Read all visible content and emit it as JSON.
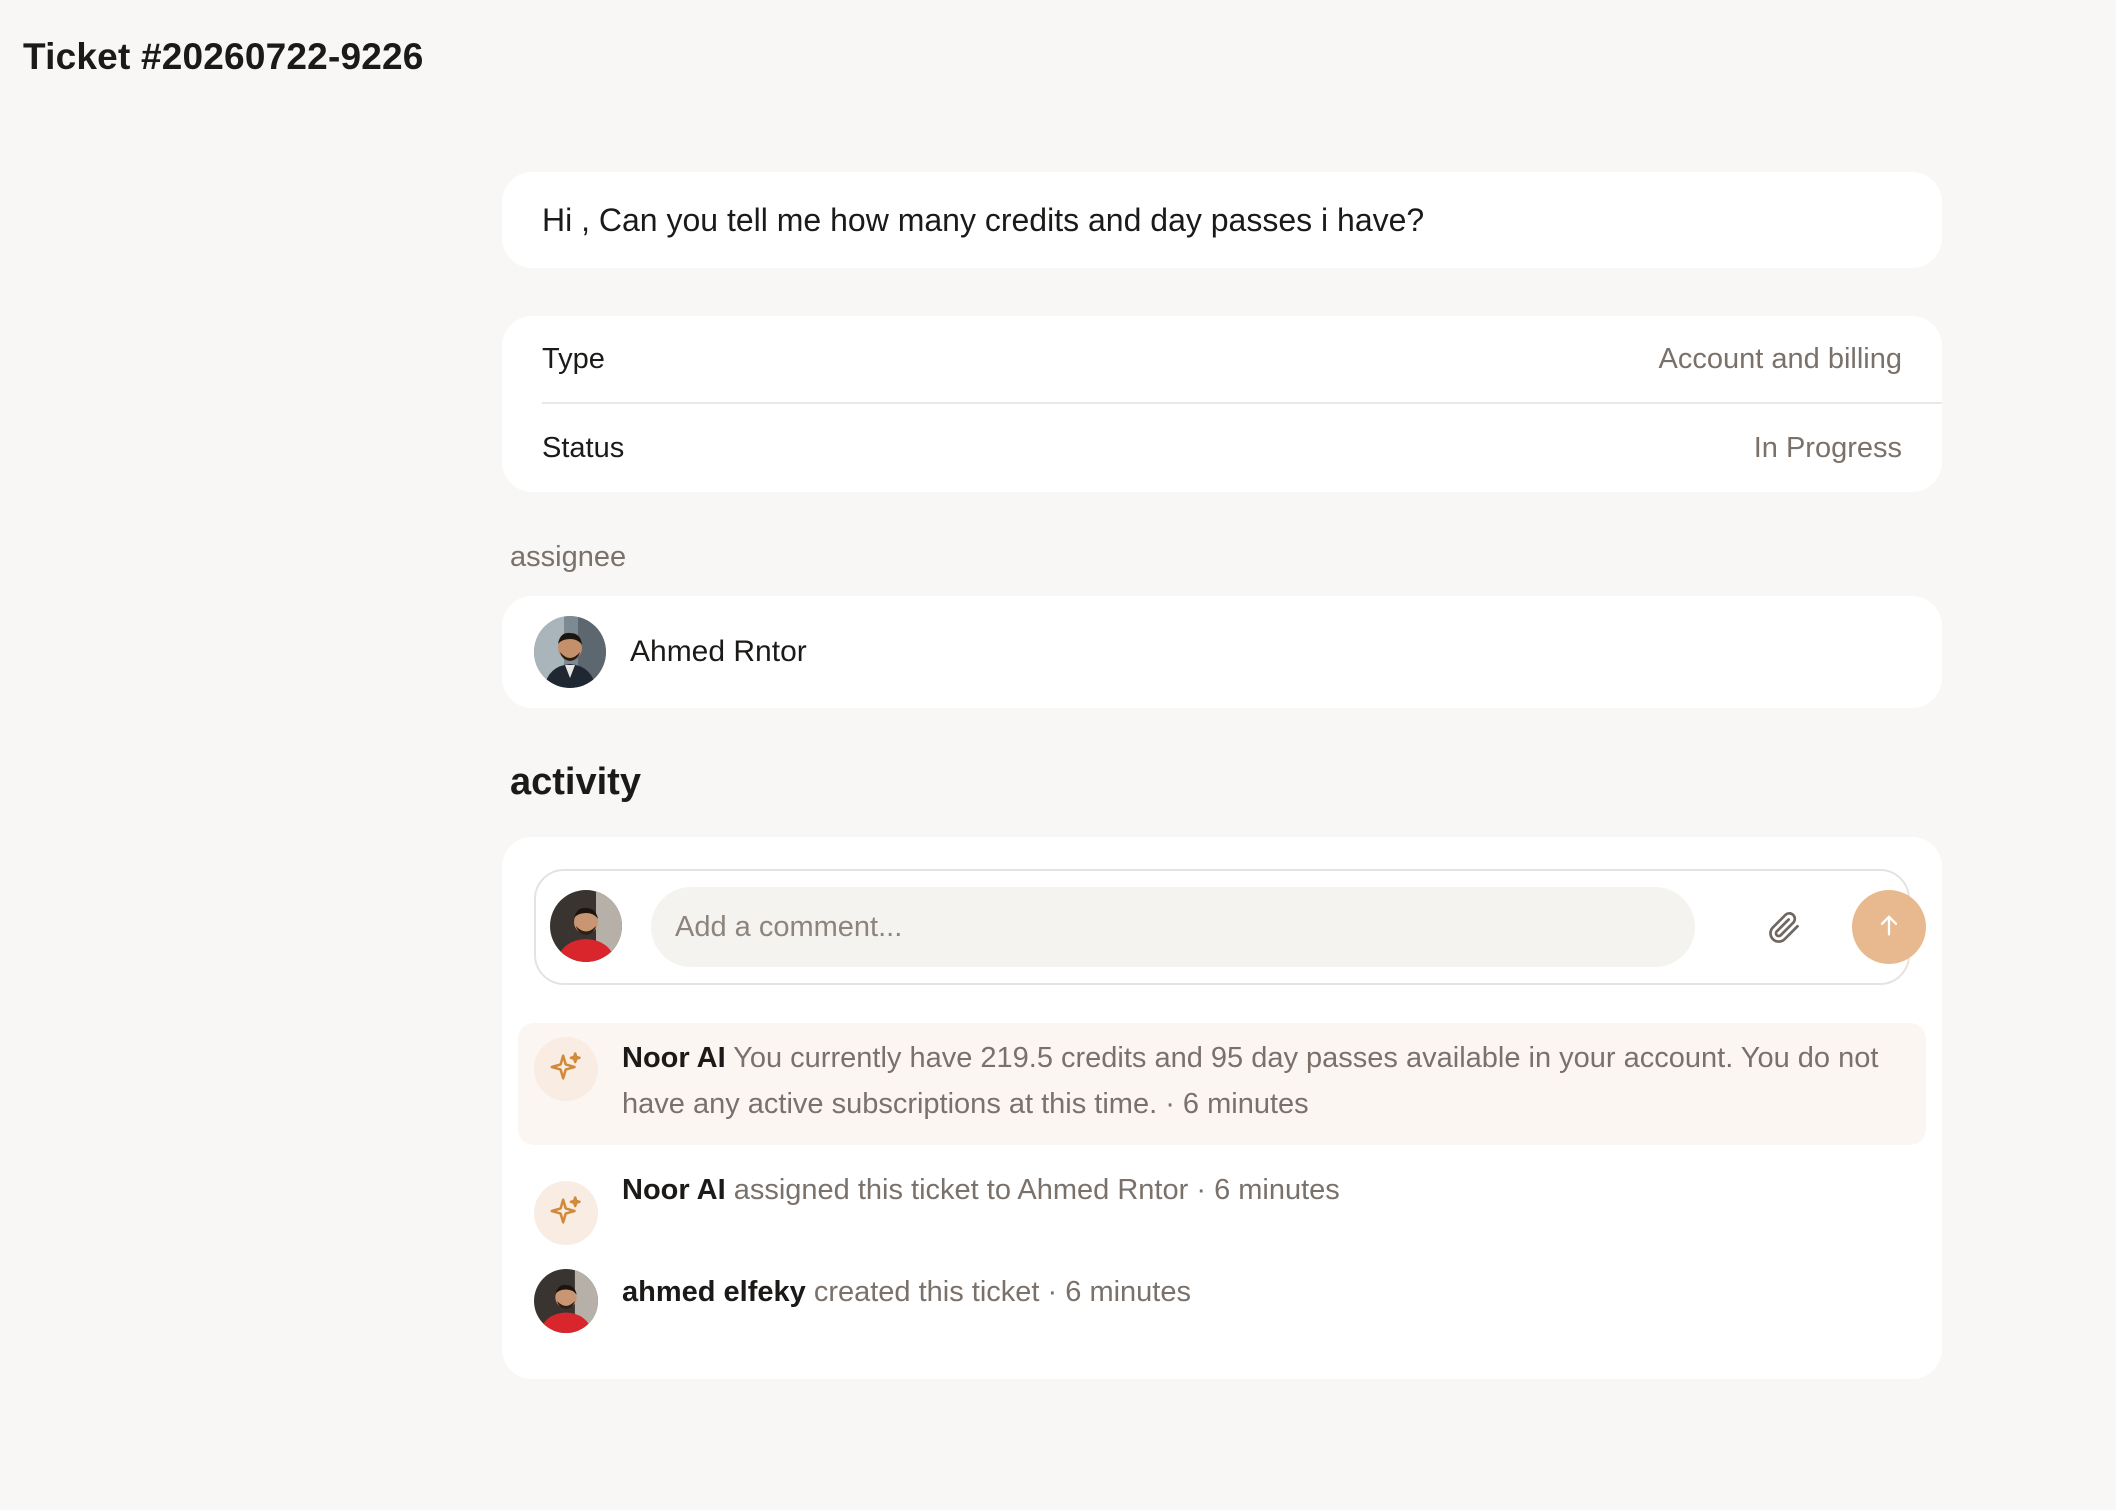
{
  "ticket": {
    "title": "Ticket #20260722-9226",
    "message": "Hi , Can you tell me how many credits and day passes i have?"
  },
  "details": {
    "type_label": "Type",
    "type_value": "Account and billing",
    "status_label": "Status",
    "status_value": "In Progress"
  },
  "assignee": {
    "label": "assignee",
    "name": "Ahmed Rntor"
  },
  "activity": {
    "heading": "activity",
    "comment_placeholder": "Add a comment...",
    "items": [
      {
        "actor": "Noor AI",
        "text": "You currently have 219.5 credits and 95 day passes available in your account. You do not have any active subscriptions at this time.",
        "sep": " · ",
        "time": "6 minutes"
      },
      {
        "actor": "Noor AI",
        "text": "assigned this ticket to Ahmed Rntor",
        "sep": " · ",
        "time": "6 minutes"
      },
      {
        "actor": "ahmed elfeky",
        "text": "created this ticket",
        "sep": " · ",
        "time": "6 minutes"
      }
    ]
  },
  "icons": {
    "ai": "sparkle-icon",
    "attach": "paperclip-icon",
    "send": "arrow-up-icon"
  },
  "colors": {
    "background": "#f8f7f5",
    "card": "#ffffff",
    "accent": "#e8b98f",
    "ai_icon": "#d08a3a",
    "muted_text": "#7a716a",
    "highlight": "#fcf6f2"
  }
}
